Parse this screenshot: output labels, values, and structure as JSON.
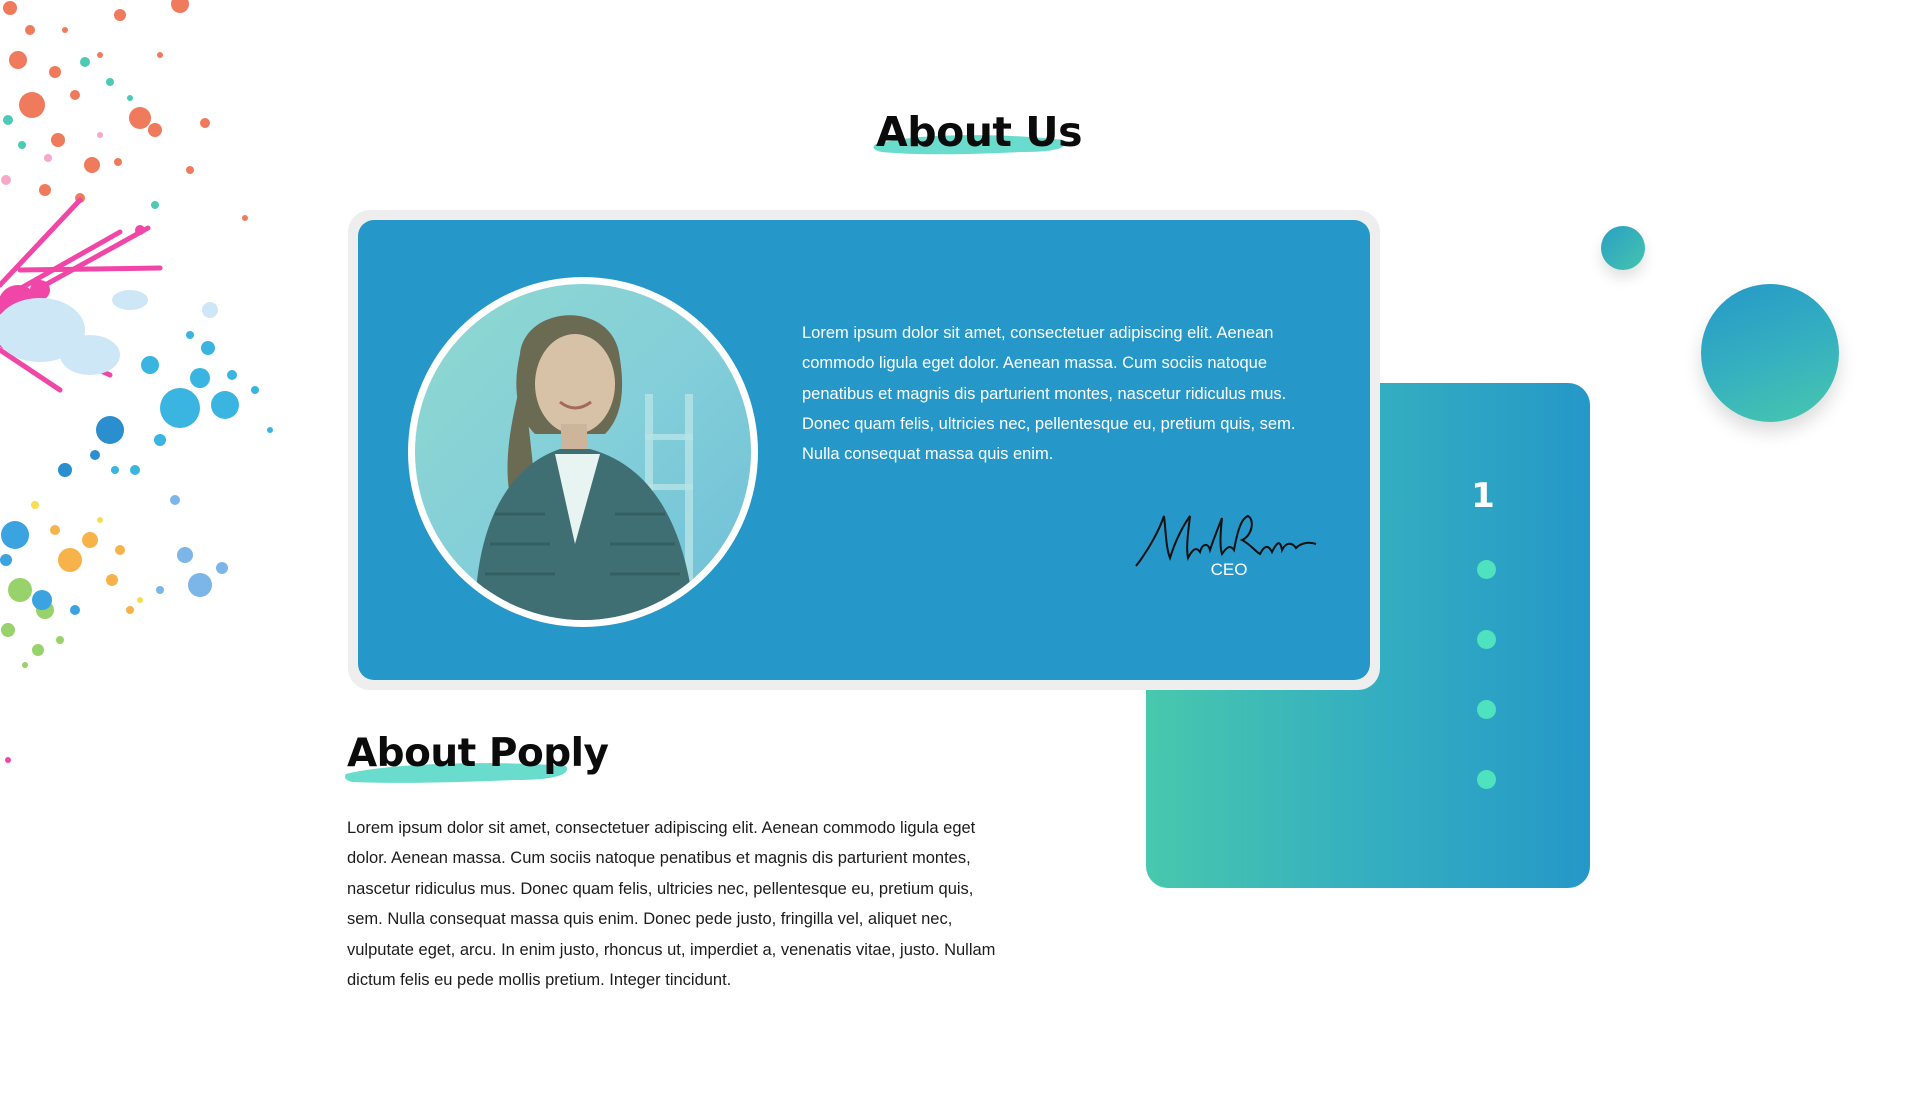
{
  "colors": {
    "card_blue": "#2597c8",
    "gradient_start": "#48c8ad",
    "gradient_end": "#2598c8",
    "dot": "#4ee2be",
    "brush": "#4fd6c4"
  },
  "about_us": {
    "title": "About Us",
    "testimonial": {
      "photo": "person-photo",
      "quote": "Lorem ipsum dolor sit amet, consectetuer adipiscing elit. Aenean commodo ligula eget dolor. Aenean massa. Cum sociis natoque penatibus et magnis dis parturient montes, nascetur ridiculus mus. Donec quam felis, ultricies nec, pellentesque eu, pretium quis, sem. Nulla consequat massa quis enim.",
      "signature": "Michael Rubino",
      "role": "CEO"
    }
  },
  "slider": {
    "current": "1",
    "dots": [
      "dot-1",
      "dot-2",
      "dot-3",
      "dot-4"
    ]
  },
  "about_poply": {
    "title": "About Poply",
    "text": "Lorem ipsum dolor sit amet, consectetuer adipiscing elit. Aenean commodo ligula eget dolor. Aenean massa. Cum sociis natoque penatibus et magnis dis parturient montes, nascetur ridiculus mus. Donec quam felis, ultricies nec, pellentesque eu, pretium quis, sem. Nulla consequat massa quis enim. Donec pede justo, fringilla vel, aliquet nec, vulputate eget, arcu. In enim justo, rhoncus ut, imperdiet a, venenatis vitae, justo. Nullam dictum felis eu pede mollis pretium. Integer tincidunt."
  }
}
